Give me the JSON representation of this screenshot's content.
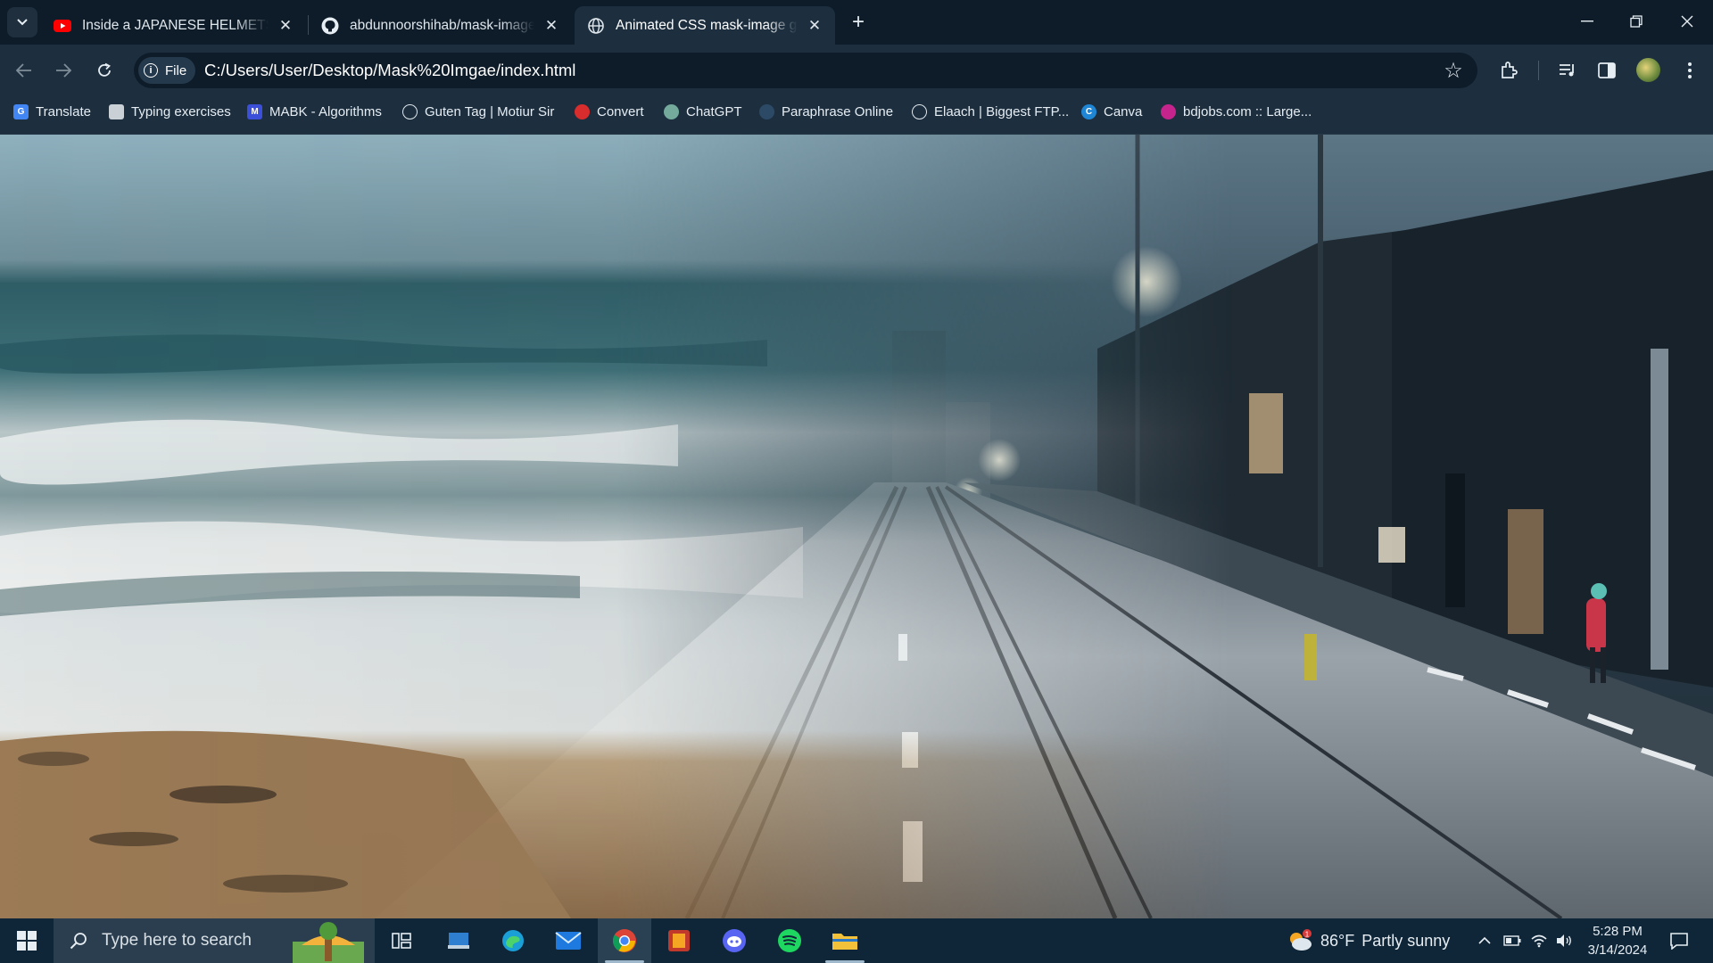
{
  "tabs": [
    {
      "title": "Inside a JAPANESE HELMETS FA",
      "favicon": "youtube-icon"
    },
    {
      "title": "abdunnoorshihab/mask-image",
      "favicon": "github-icon"
    },
    {
      "title": "Animated CSS mask-image grad",
      "favicon": "globe-icon",
      "active": true
    }
  ],
  "toolbar": {
    "chip_label": "File",
    "url": "C:/Users/User/Desktop/Mask%20Imgae/index.html"
  },
  "bookmarks": [
    {
      "label": "Translate",
      "icon": "google-translate-icon"
    },
    {
      "label": "Typing exercises",
      "icon": "typing-icon"
    },
    {
      "label": "MABK - Algorithms",
      "icon": "mabk-icon"
    },
    {
      "label": "Guten Tag | Motiur Sir",
      "icon": "globe-icon"
    },
    {
      "label": "Convert",
      "icon": "convert-icon"
    },
    {
      "label": "ChatGPT",
      "icon": "chatgpt-icon"
    },
    {
      "label": "Paraphrase Online",
      "icon": "cloud-icon"
    },
    {
      "label": "Elaach | Biggest FTP...",
      "icon": "globe-icon"
    },
    {
      "label": "Canva",
      "icon": "canva-icon"
    },
    {
      "label": "bdjobs.com :: Large...",
      "icon": "bdjobs-icon"
    }
  ],
  "content": {
    "scene": "beach waves blended via mask-image gradient into rainy city street with tram tracks"
  },
  "taskbar": {
    "search_placeholder": "Type here to search",
    "apps": [
      "task-view-icon",
      "file-manager-icon",
      "edge-icon",
      "mail-icon",
      "chrome-icon",
      "app-icon",
      "discord-icon",
      "spotify-icon",
      "file-explorer-icon"
    ],
    "weather": {
      "temp": "86°F",
      "condition": "Partly sunny",
      "badge": "1"
    },
    "clock": {
      "time": "5:28 PM",
      "date": "3/14/2024"
    }
  },
  "colors": {
    "tabstrip": "#0e1c29",
    "toolbar": "#1d2f3f",
    "taskbar": "#0f2638"
  }
}
